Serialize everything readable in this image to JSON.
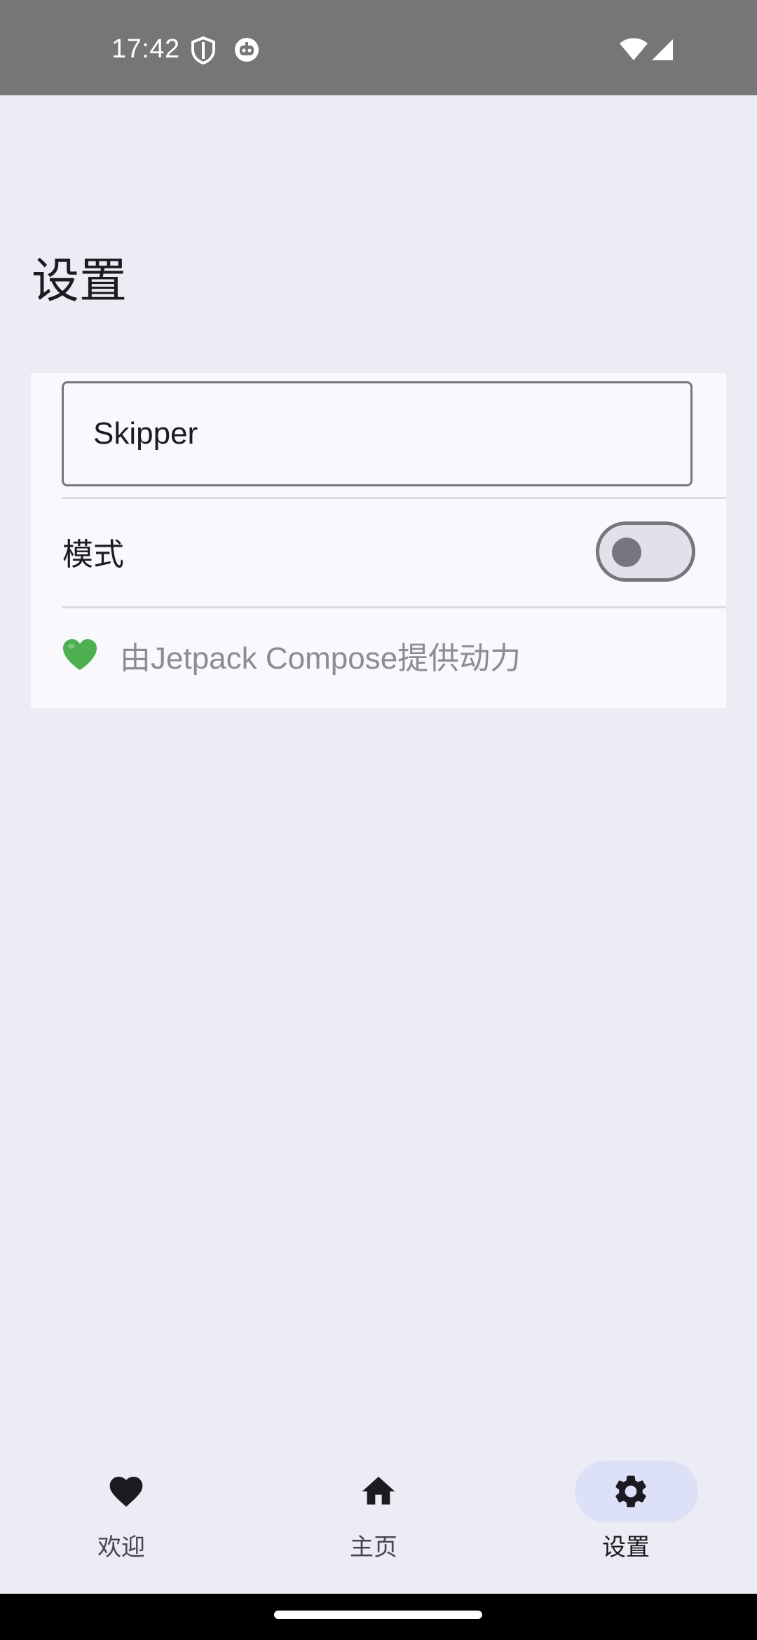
{
  "status_bar": {
    "time": "17:42",
    "icons": [
      "shield-icon",
      "robot-icon",
      "wifi-icon",
      "signal-icon"
    ],
    "background": "#767676"
  },
  "page": {
    "title": "设置"
  },
  "settings": {
    "name_field": {
      "value": "Skipper",
      "placeholder": ""
    },
    "mode": {
      "label": "模式",
      "enabled": false
    },
    "powered_by": {
      "icon": "green-heart-emoji",
      "text": "由Jetpack Compose提供动力"
    }
  },
  "bottom_nav": {
    "items": [
      {
        "label": "欢迎",
        "icon": "heart-icon",
        "active": false
      },
      {
        "label": "主页",
        "icon": "home-icon",
        "active": false
      },
      {
        "label": "设置",
        "icon": "gear-icon",
        "active": true
      }
    ],
    "active_indicator_color": "#DCE1F8"
  },
  "colors": {
    "background": "#ECECF5",
    "card": "#F8F8FD",
    "outline": "#76767E",
    "accent_green": "#4CAF50"
  }
}
